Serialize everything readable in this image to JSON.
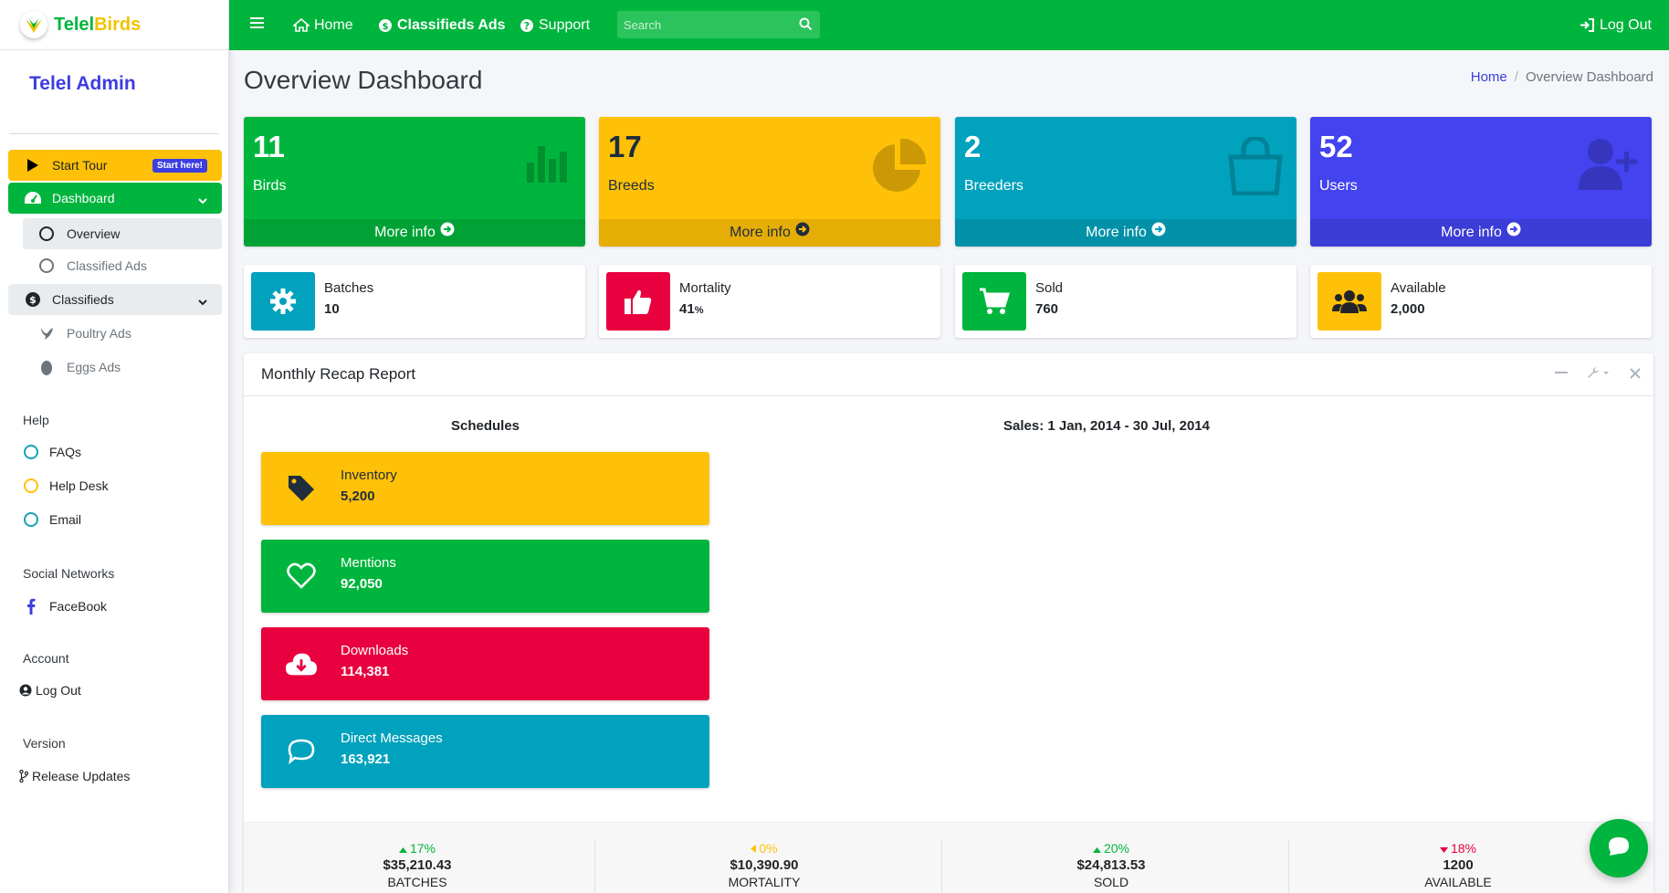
{
  "brand": {
    "part1": "Telel",
    "part2": "Birds"
  },
  "sidebar": {
    "admin_title": "Telel Admin",
    "start_tour": {
      "label": "Start Tour",
      "badge": "Start here!"
    },
    "dashboard": {
      "label": "Dashboard",
      "children": [
        {
          "label": "Overview"
        },
        {
          "label": "Classified Ads"
        }
      ]
    },
    "classifieds": {
      "label": "Classifieds",
      "children": [
        {
          "label": "Poultry Ads"
        },
        {
          "label": "Eggs Ads"
        }
      ]
    },
    "help": {
      "header": "Help",
      "items": [
        {
          "label": "FAQs",
          "color": "#17a2b8"
        },
        {
          "label": "Help Desk",
          "color": "#ffc107"
        },
        {
          "label": "Email",
          "color": "#17a2b8"
        }
      ]
    },
    "social": {
      "header": "Social Networks",
      "items": [
        {
          "label": "FaceBook"
        }
      ]
    },
    "account": {
      "header": "Account",
      "items": [
        {
          "label": "Log Out"
        }
      ]
    },
    "version": {
      "header": "Version",
      "items": [
        {
          "label": "Release Updates"
        }
      ]
    }
  },
  "topbar": {
    "home": "Home",
    "classifieds": "Classifieds Ads",
    "support": "Support",
    "search_placeholder": "Search",
    "logout": "Log Out"
  },
  "page": {
    "title": "Overview Dashboard",
    "breadcrumb": [
      "Home",
      "/",
      "Overview Dashboard"
    ]
  },
  "small_boxes": [
    {
      "value": "11",
      "label": "Birds",
      "footer": "More info",
      "color": "#00b53d",
      "icon": "bar-chart-icon"
    },
    {
      "value": "17",
      "label": "Breeds",
      "footer": "More info",
      "color": "#ffc107",
      "icon": "pie-chart-icon"
    },
    {
      "value": "2",
      "label": "Breeders",
      "footer": "More info",
      "color": "#00a2bd",
      "icon": "shopping-bag-icon"
    },
    {
      "value": "52",
      "label": "Users",
      "footer": "More info",
      "color": "#4343ef",
      "icon": "user-plus-icon"
    }
  ],
  "info_boxes": [
    {
      "label": "Batches",
      "value": "10",
      "suffix": "",
      "color": "#00a2bd",
      "icon": "gear-icon"
    },
    {
      "label": "Mortality",
      "value": "41",
      "suffix": "%",
      "color": "#e8003f",
      "icon": "thumbs-up-icon"
    },
    {
      "label": "Sold",
      "value": "760",
      "suffix": "",
      "color": "#00b53d",
      "icon": "cart-icon"
    },
    {
      "label": "Available",
      "value": "2,000",
      "suffix": "",
      "color": "#ffc107",
      "icon": "users-icon"
    }
  ],
  "report": {
    "title": "Monthly Recap Report",
    "schedules_title": "Schedules",
    "sales_title": "Sales: 1 Jan, 2014 - 30 Jul, 2014",
    "schedules": [
      {
        "label": "Inventory",
        "value": "5,200",
        "color": "#ffc107",
        "icon": "tag-icon"
      },
      {
        "label": "Mentions",
        "value": "92,050",
        "color": "#00b53d",
        "icon": "heart-icon"
      },
      {
        "label": "Downloads",
        "value": "114,381",
        "color": "#e8003f",
        "icon": "cloud-download-icon"
      },
      {
        "label": "Direct Messages",
        "value": "163,921",
        "color": "#00a2bd",
        "icon": "comment-icon"
      }
    ],
    "footer": [
      {
        "pct": "17%",
        "amount": "$35,210.43",
        "caption": "BATCHES",
        "trend": "up",
        "color": "#00b53d"
      },
      {
        "pct": "0%",
        "amount": "$10,390.90",
        "caption": "MORTALITY",
        "trend": "left",
        "color": "#ffc107"
      },
      {
        "pct": "20%",
        "amount": "$24,813.53",
        "caption": "SOLD",
        "trend": "up",
        "color": "#00b53d"
      },
      {
        "pct": "18%",
        "amount": "1200",
        "caption": "AVAILABLE",
        "trend": "down",
        "color": "#e8003f"
      }
    ]
  }
}
